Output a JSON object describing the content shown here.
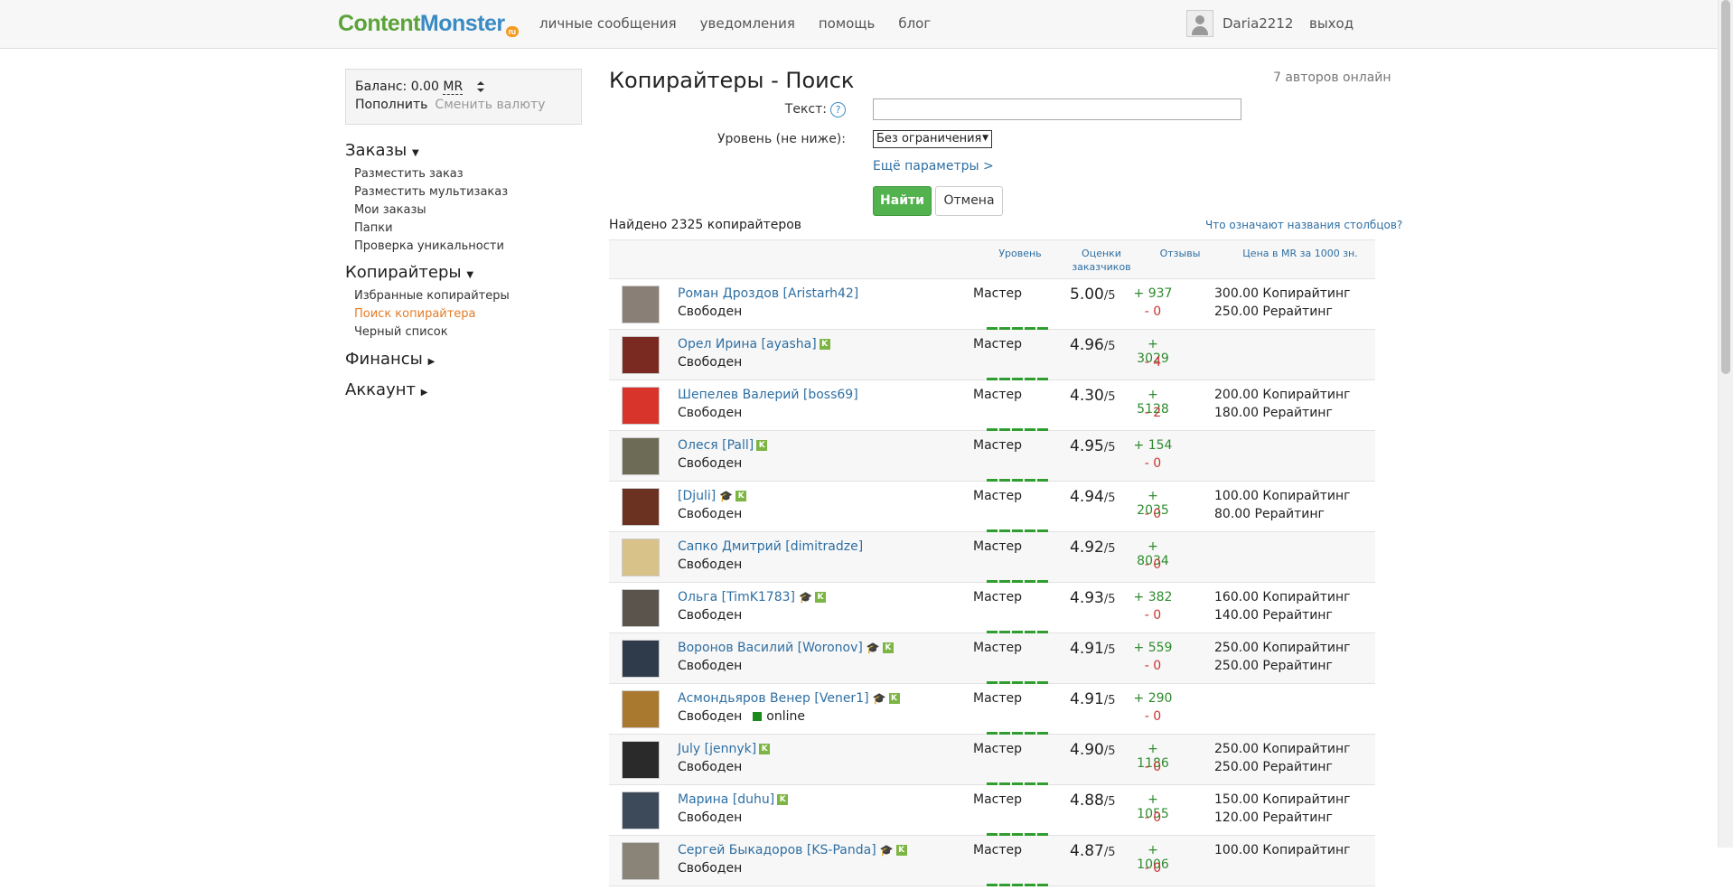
{
  "header": {
    "logo_part1": "Content",
    "logo_part2": "Monster",
    "logo_ru": "ru",
    "nav": [
      "личные сообщения",
      "уведомления",
      "помощь",
      "блог"
    ],
    "username": "Daria2212",
    "logout": "выход"
  },
  "balance": {
    "label": "Баланс: 0.00",
    "currency": "MR",
    "swap_icon": "swap-arrows-icon",
    "topup": "Пополнить",
    "change_currency": "Сменить валюту"
  },
  "sidebar": {
    "orders_title": "Заказы",
    "orders_items": [
      "Разместить заказ",
      "Разместить мультизаказ",
      "Мои заказы",
      "Папки",
      "Проверка уникальности"
    ],
    "writers_title": "Копирайтеры",
    "writers_items": [
      "Избранные копирайтеры",
      "Поиск копирайтера",
      "Черный список"
    ],
    "finance_title": "Финансы",
    "account_title": "Аккаунт"
  },
  "search": {
    "title": "Копирайтеры - Поиск",
    "online_count": "7 авторов онлайн",
    "text_label": "Текст:",
    "help_glyph": "?",
    "text_value": "",
    "level_label": "Уровень (не ниже):",
    "level_value": "Без ограничения",
    "more_params": "Ещё параметры >",
    "find_button": "Найти",
    "cancel_button": "Отмена",
    "found": "Найдено 2325 копирайтеров",
    "columns_help": "Что означают названия столбцов?"
  },
  "table": {
    "columns": {
      "level": "Уровень",
      "ratings_line1": "Оценки",
      "ratings_line2": "заказчиков",
      "reviews": "Отзывы",
      "price": "Цена в MR за 1000 зн."
    },
    "score_suffix": "/5",
    "rows": [
      {
        "name": "Роман Дроздов [Aristarh42]",
        "status": "Свободен",
        "level": "Мастер",
        "score": "5.00",
        "pos": "+ 937",
        "neg": "- 0",
        "price1": "300.00 Копирайтинг",
        "price2": "250.00  Рерайтинг",
        "k": false,
        "cap": false,
        "online": "",
        "avatar_color": "#8a7f76"
      },
      {
        "name": "Орел Ирина [ayasha]",
        "status": "Свободен",
        "level": "Мастер",
        "score": "4.96",
        "pos": "+ 3029",
        "neg": "- 4",
        "price1": "",
        "price2": "",
        "k": true,
        "cap": false,
        "online": "",
        "avatar_color": "#7a2a20"
      },
      {
        "name": "Шепелев Валерий [boss69]",
        "status": "Свободен",
        "level": "Мастер",
        "score": "4.30",
        "pos": "+ 5128",
        "neg": "- 2",
        "price1": "200.00 Копирайтинг",
        "price2": "180.00  Рерайтинг",
        "k": false,
        "cap": false,
        "online": "",
        "avatar_color": "#d8342c"
      },
      {
        "name": "Олеся [Pall]",
        "status": "Свободен",
        "level": "Мастер",
        "score": "4.95",
        "pos": "+ 154",
        "neg": "- 0",
        "price1": "",
        "price2": "",
        "k": true,
        "cap": false,
        "online": "",
        "avatar_color": "#6d6a55"
      },
      {
        "name": "[Djuli]",
        "status": "Свободен",
        "level": "Мастер",
        "score": "4.94",
        "pos": "+ 2035",
        "neg": "- 0",
        "price1": "100.00 Копирайтинг",
        "price2": "80.00  Рерайтинг",
        "k": true,
        "cap": true,
        "online": "",
        "avatar_color": "#6b3222"
      },
      {
        "name": "Сапко Дмитрий [dimitradze]",
        "status": "Свободен",
        "level": "Мастер",
        "score": "4.92",
        "pos": "+ 8034",
        "neg": "- 0",
        "price1": "",
        "price2": "",
        "k": false,
        "cap": false,
        "online": "",
        "avatar_color": "#d9c28a"
      },
      {
        "name": "Ольга [TimK1783]",
        "status": "Свободен",
        "level": "Мастер",
        "score": "4.93",
        "pos": "+ 382",
        "neg": "- 0",
        "price1": "160.00 Копирайтинг",
        "price2": "140.00  Рерайтинг",
        "k": true,
        "cap": true,
        "online": "",
        "avatar_color": "#5a544c"
      },
      {
        "name": "Воронов Василий [Woronov]",
        "status": "Свободен",
        "level": "Мастер",
        "score": "4.91",
        "pos": "+ 559",
        "neg": "- 0",
        "price1": "250.00 Копирайтинг",
        "price2": "250.00  Рерайтинг",
        "k": true,
        "cap": true,
        "online": "",
        "avatar_color": "#2f3a4a"
      },
      {
        "name": "Асмондьяров Венер [Vener1]",
        "status": "Свободен",
        "level": "Мастер",
        "score": "4.91",
        "pos": "+ 290",
        "neg": "- 0",
        "price1": "",
        "price2": "",
        "k": true,
        "cap": true,
        "online": "online",
        "avatar_color": "#a8792f"
      },
      {
        "name": "July [jennyk]",
        "status": "Свободен",
        "level": "Мастер",
        "score": "4.90",
        "pos": "+ 1186",
        "neg": "- 0",
        "price1": "250.00 Копирайтинг",
        "price2": "250.00  Рерайтинг",
        "k": true,
        "cap": false,
        "online": "",
        "avatar_color": "#2a2a2a"
      },
      {
        "name": "Марина [duhu]",
        "status": "Свободен",
        "level": "Мастер",
        "score": "4.88",
        "pos": "+ 1055",
        "neg": "- 0",
        "price1": "150.00 Копирайтинг",
        "price2": "120.00  Рерайтинг",
        "k": true,
        "cap": false,
        "online": "",
        "avatar_color": "#3d4a5a"
      },
      {
        "name": "Сергей Быкадоров [KS-Panda]",
        "status": "Свободен",
        "level": "Мастер",
        "score": "4.87",
        "pos": "+ 1006",
        "neg": "- 0",
        "price1": "100.00 Копирайтинг",
        "price2": "",
        "k": true,
        "cap": true,
        "online": "",
        "avatar_color": "#8a8378"
      }
    ]
  }
}
